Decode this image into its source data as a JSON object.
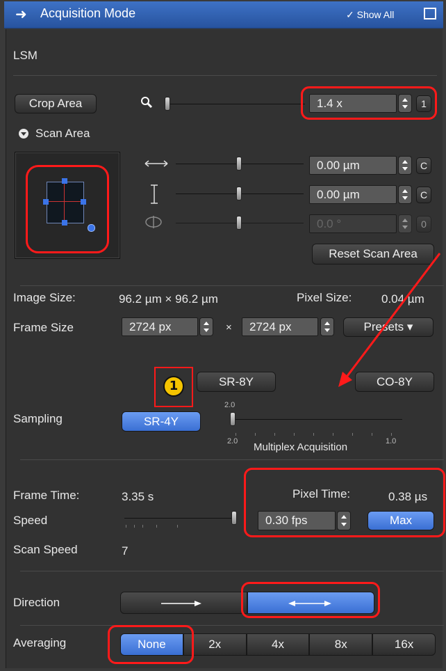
{
  "title": "Acquisition Mode",
  "show_all": "Show All",
  "section_lsm": "LSM",
  "crop_area": "Crop Area",
  "zoom": {
    "value": "1.4 x",
    "reset_label": "1",
    "slider_fraction": 0.02
  },
  "scan_area": {
    "label": "Scan Area",
    "offset_x": {
      "value": "0.00 µm",
      "reset_label": "C"
    },
    "offset_y": {
      "value": "0.00 µm",
      "reset_label": "C"
    },
    "rotation": {
      "value": "0.0 °",
      "reset_label": "0"
    },
    "reset_button": "Reset Scan Area"
  },
  "image_size": {
    "label": "Image Size:",
    "value": "96.2 µm × 96.2 µm"
  },
  "pixel_size": {
    "label": "Pixel Size:",
    "value": "0.04 µm"
  },
  "frame_size": {
    "label": "Frame Size",
    "x_value": "2724 px",
    "times": "×",
    "y_value": "2724 px",
    "presets": "Presets ▾"
  },
  "modes": {
    "sr8y": "SR-8Y",
    "co8y": "CO-8Y",
    "sr4y": "SR-4Y"
  },
  "badge": "1",
  "sampling": {
    "label": "Sampling",
    "scale_top": "2.0",
    "scale_left": "2.0",
    "caption": "Multiplex Acquisition",
    "scale_right": "1.0"
  },
  "frame_time": {
    "label": "Frame Time:",
    "value": "3.35 s"
  },
  "pixel_time": {
    "label": "Pixel Time:",
    "value": "0.38 µs"
  },
  "speed": {
    "label": "Speed",
    "fps": "0.30 fps",
    "max": "Max"
  },
  "scan_speed": {
    "label": "Scan Speed",
    "value": "7"
  },
  "direction": {
    "label": "Direction",
    "selected": "bidirectional"
  },
  "averaging": {
    "label": "Averaging",
    "options": [
      "None",
      "2x",
      "4x",
      "8x",
      "16x"
    ],
    "selected": "None"
  },
  "colors": {
    "accent": "#3a6fd3",
    "highlight": "#ff1a1a",
    "badge": "#f5c400"
  }
}
